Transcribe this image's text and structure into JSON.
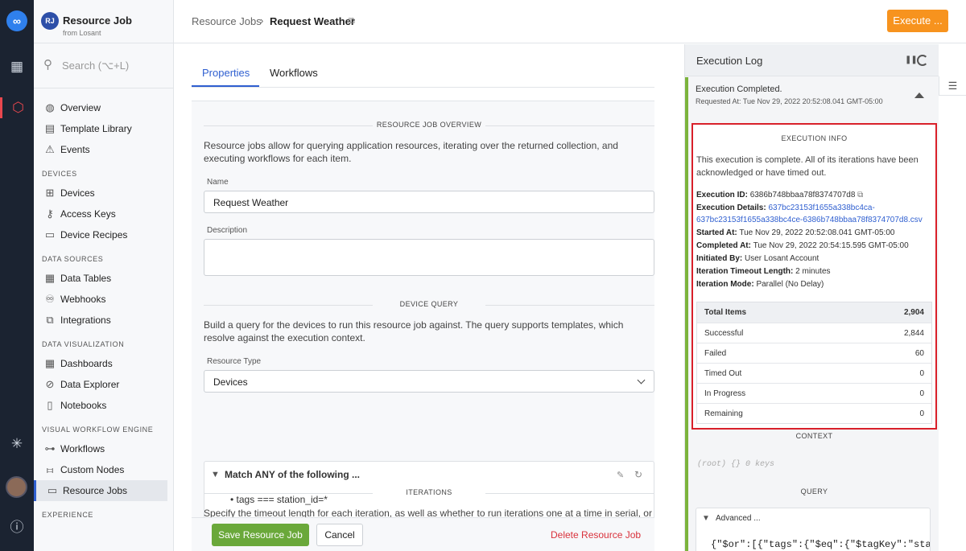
{
  "app": {
    "badge": "RJ",
    "name": "Resource Job",
    "sub": "from Losant"
  },
  "search": {
    "placeholder": "Search (⌥+L)"
  },
  "sidebar": {
    "top_items": [
      {
        "label": "Overview",
        "icon": "globe-icon"
      },
      {
        "label": "Template Library",
        "icon": "template-icon"
      },
      {
        "label": "Events",
        "icon": "warning-icon"
      }
    ],
    "sections": [
      {
        "heading": "DEVICES",
        "items": [
          {
            "label": "Devices",
            "icon": "chip-icon"
          },
          {
            "label": "Access Keys",
            "icon": "key-icon"
          },
          {
            "label": "Device Recipes",
            "icon": "recipe-icon"
          }
        ]
      },
      {
        "heading": "DATA SOURCES",
        "items": [
          {
            "label": "Data Tables",
            "icon": "table-icon"
          },
          {
            "label": "Webhooks",
            "icon": "webhook-icon"
          },
          {
            "label": "Integrations",
            "icon": "integration-icon"
          }
        ]
      },
      {
        "heading": "DATA VISUALIZATION",
        "items": [
          {
            "label": "Dashboards",
            "icon": "dashboard-icon"
          },
          {
            "label": "Data Explorer",
            "icon": "compass-icon"
          },
          {
            "label": "Notebooks",
            "icon": "notebook-icon"
          }
        ]
      },
      {
        "heading": "VISUAL WORKFLOW ENGINE",
        "items": [
          {
            "label": "Workflows",
            "icon": "workflow-icon"
          },
          {
            "label": "Custom Nodes",
            "icon": "sliders-icon"
          },
          {
            "label": "Resource Jobs",
            "icon": "resource-job-icon",
            "active": true
          }
        ]
      },
      {
        "heading": "EXPERIENCE",
        "items": []
      }
    ]
  },
  "breadcrumb": {
    "parent": "Resource Jobs",
    "separator": "›",
    "current": "Request Weather"
  },
  "execute_button": "Execute ...",
  "tabs": [
    {
      "label": "Properties",
      "active": true
    },
    {
      "label": "Workflows",
      "active": false
    }
  ],
  "overview": {
    "title": "RESOURCE JOB OVERVIEW",
    "description": "Resource jobs allow for querying application resources, iterating over the returned collection, and executing workflows for each item.",
    "name_label": "Name",
    "name_value": "Request Weather",
    "description_label": "Description",
    "description_value": ""
  },
  "device_query": {
    "title": "DEVICE QUERY",
    "description": "Build a query for the devices to run this resource job against. The query supports templates, which resolve against the execution context.",
    "resource_type_label": "Resource Type",
    "resource_type_value": "Devices",
    "match_title": "Match ANY of the following ...",
    "rule": "tags === station_id=*"
  },
  "iterations": {
    "title": "ITERATIONS",
    "description": "Specify the timeout length for each iteration, as well as whether to run iterations one at a time in serial, or"
  },
  "footer": {
    "save": "Save Resource Job",
    "cancel": "Cancel",
    "delete": "Delete Resource Job"
  },
  "log": {
    "title": "Execution Log",
    "entry_title": "Execution Completed.",
    "entry_time": "Requested At: Tue Nov 29, 2022 20:52:08.041 GMT-05:00",
    "info_title": "EXECUTION INFO",
    "info_desc": "This execution is complete. All of its iterations have been acknowledged or have timed out.",
    "execution_id_label": "Execution ID:",
    "execution_id": "6386b748bbaa78f8374707d8",
    "details_label": "Execution Details:",
    "details_link": "637bc23153f1655a338bc4ca-637bc23153f1655a338bc4ce-6386b748bbaa78f8374707d8.csv",
    "started_label": "Started At:",
    "started": "Tue Nov 29, 2022 20:52:08.041 GMT-05:00",
    "completed_label": "Completed At:",
    "completed": "Tue Nov 29, 2022 20:54:15.595 GMT-05:00",
    "initiated_label": "Initiated By:",
    "initiated": "User Losant Account",
    "timeout_label": "Iteration Timeout Length:",
    "timeout": "2 minutes",
    "mode_label": "Iteration Mode:",
    "mode": "Parallel (No Delay)",
    "stats": [
      {
        "label": "Total Items",
        "value": "2,904"
      },
      {
        "label": "Successful",
        "value": "2,844"
      },
      {
        "label": "Failed",
        "value": "60"
      },
      {
        "label": "Timed Out",
        "value": "0"
      },
      {
        "label": "In Progress",
        "value": "0"
      },
      {
        "label": "Remaining",
        "value": "0"
      }
    ],
    "context_title": "CONTEXT",
    "context_body": "(root) {} 0 keys",
    "query_title": "QUERY",
    "advanced_title": "Advanced ...",
    "advanced_code": "{\"$or\":[{\"tags\":{\"$eq\":{\"$tagKey\":\"stat"
  }
}
